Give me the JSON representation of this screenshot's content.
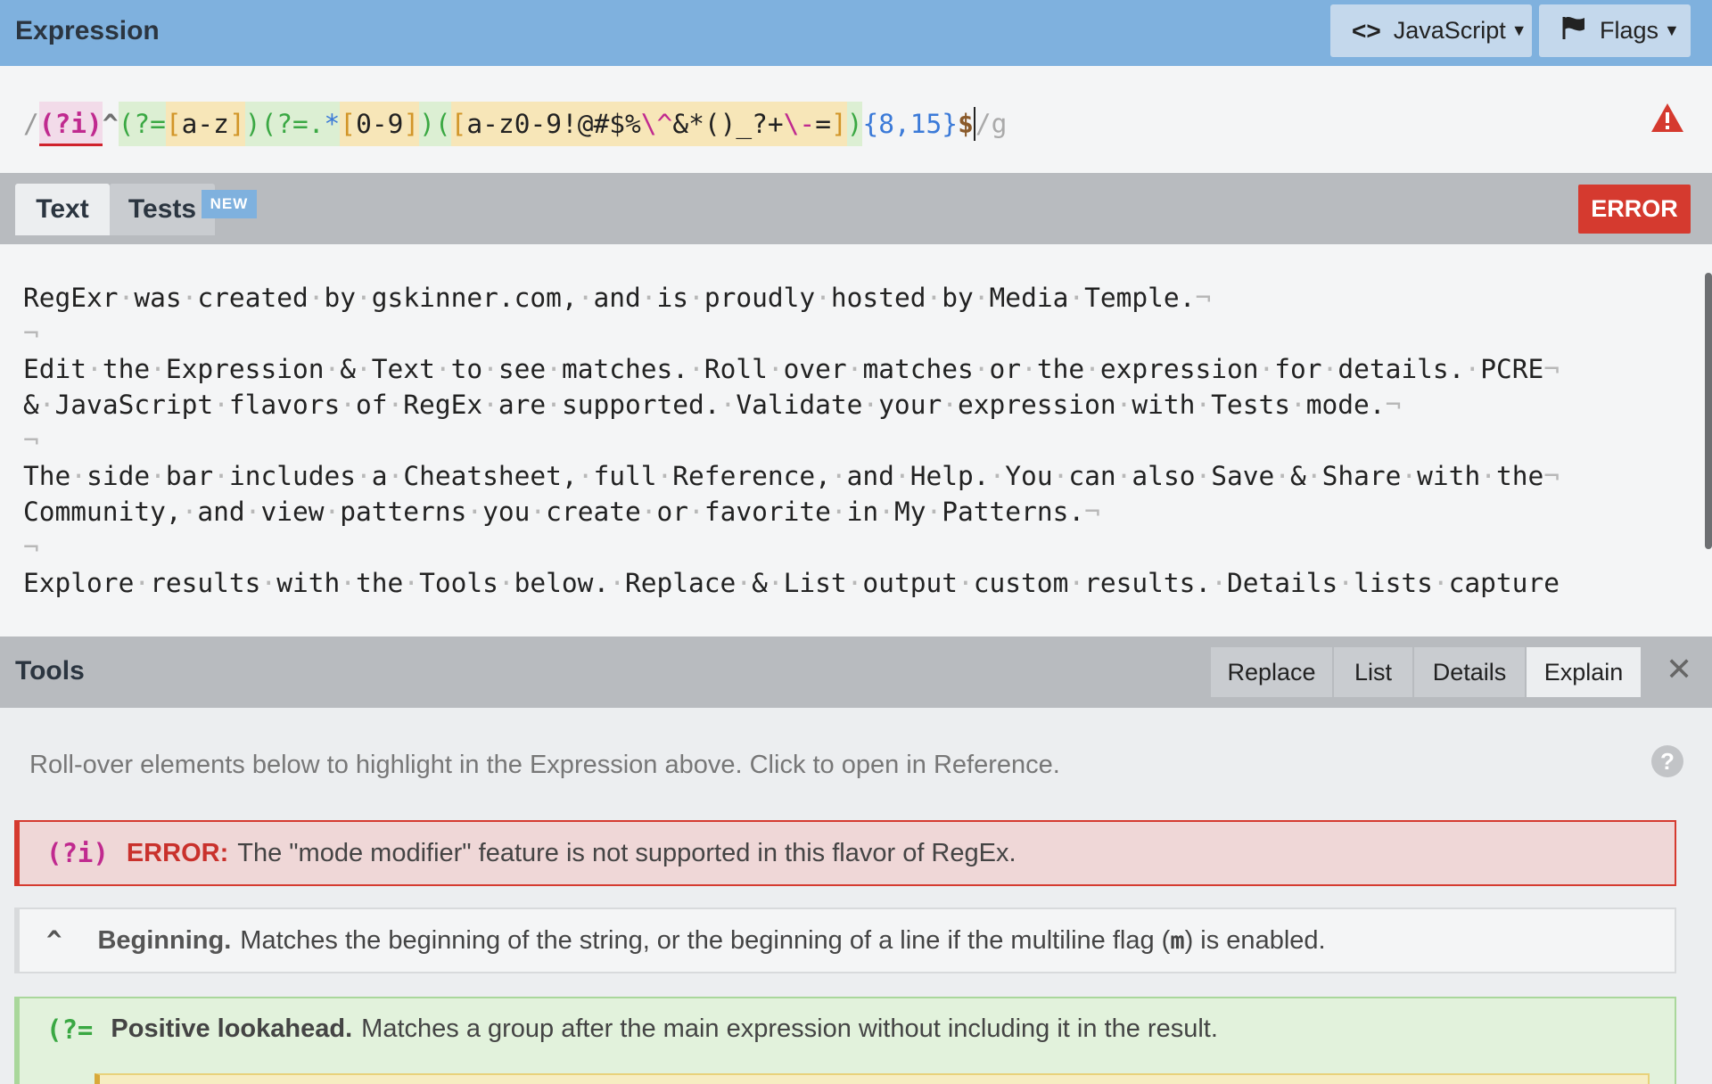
{
  "expression_panel": {
    "title": "Expression",
    "flavor_button": "JavaScript",
    "flags_button": "Flags"
  },
  "expression": {
    "open_slash": "/",
    "tokens": [
      "(?i)",
      "^",
      "(?=",
      "[",
      "a-z",
      "]",
      ")",
      "(?=",
      ".",
      "*",
      "[",
      "0-9",
      "]",
      ")",
      "(",
      "[",
      "a-z0-9!@#$%",
      "\\^",
      "&*()_?+",
      "\\-",
      "=",
      "]",
      ")",
      "{8,15}",
      "$"
    ],
    "close_slash": "/",
    "flags": "g"
  },
  "text_panel": {
    "tabs": [
      {
        "label": "Text"
      },
      {
        "label": "Tests"
      }
    ],
    "new_badge": "NEW",
    "status_button": "ERROR",
    "lines": [
      "RegExr was created by gskinner.com, and is proudly hosted by Media Temple.",
      "",
      "Edit the Expression & Text to see matches. Roll over matches or the expression for details. PCRE",
      "& JavaScript flavors of RegEx are supported. Validate your expression with Tests mode.",
      "",
      "The side bar includes a Cheatsheet, full Reference, and Help. You can also Save & Share with the",
      "Community, and view patterns you create or favorite in My Patterns.",
      "",
      "Explore results with the Tools below. Replace & List output custom results. Details lists capture"
    ]
  },
  "tools_panel": {
    "title": "Tools",
    "tabs": [
      {
        "label": "Replace"
      },
      {
        "label": "List"
      },
      {
        "label": "Details"
      },
      {
        "label": "Explain"
      }
    ],
    "active_tab": "Explain",
    "close": "✕",
    "hint": "Roll-over elements below to highlight in the Expression above. Click to open in Reference.",
    "help": "?",
    "items": [
      {
        "token": "(?i)",
        "label": "ERROR:",
        "text": "The \"mode modifier\" feature is not supported in this flavor of RegEx."
      },
      {
        "token": "^",
        "label": "Beginning.",
        "text_before": "Matches the beginning of the string, or the beginning of a line if the multiline flag (",
        "code": "m",
        "text_after": ") is enabled."
      },
      {
        "token": "(?=",
        "label": "Positive lookahead.",
        "text": "Matches a group after the main expression without including it in the result."
      }
    ]
  },
  "colors": {
    "header_blue": "#7fb1de",
    "error_red": "#d53a2f",
    "group_green": "#3aa843",
    "set_orange": "#d29528",
    "modifier_magenta": "#c02a8f",
    "quantifier_blue": "#3b7ad8"
  },
  "icons": [
    "code-icon",
    "flag-icon",
    "warning-icon",
    "close-icon",
    "help-icon"
  ]
}
